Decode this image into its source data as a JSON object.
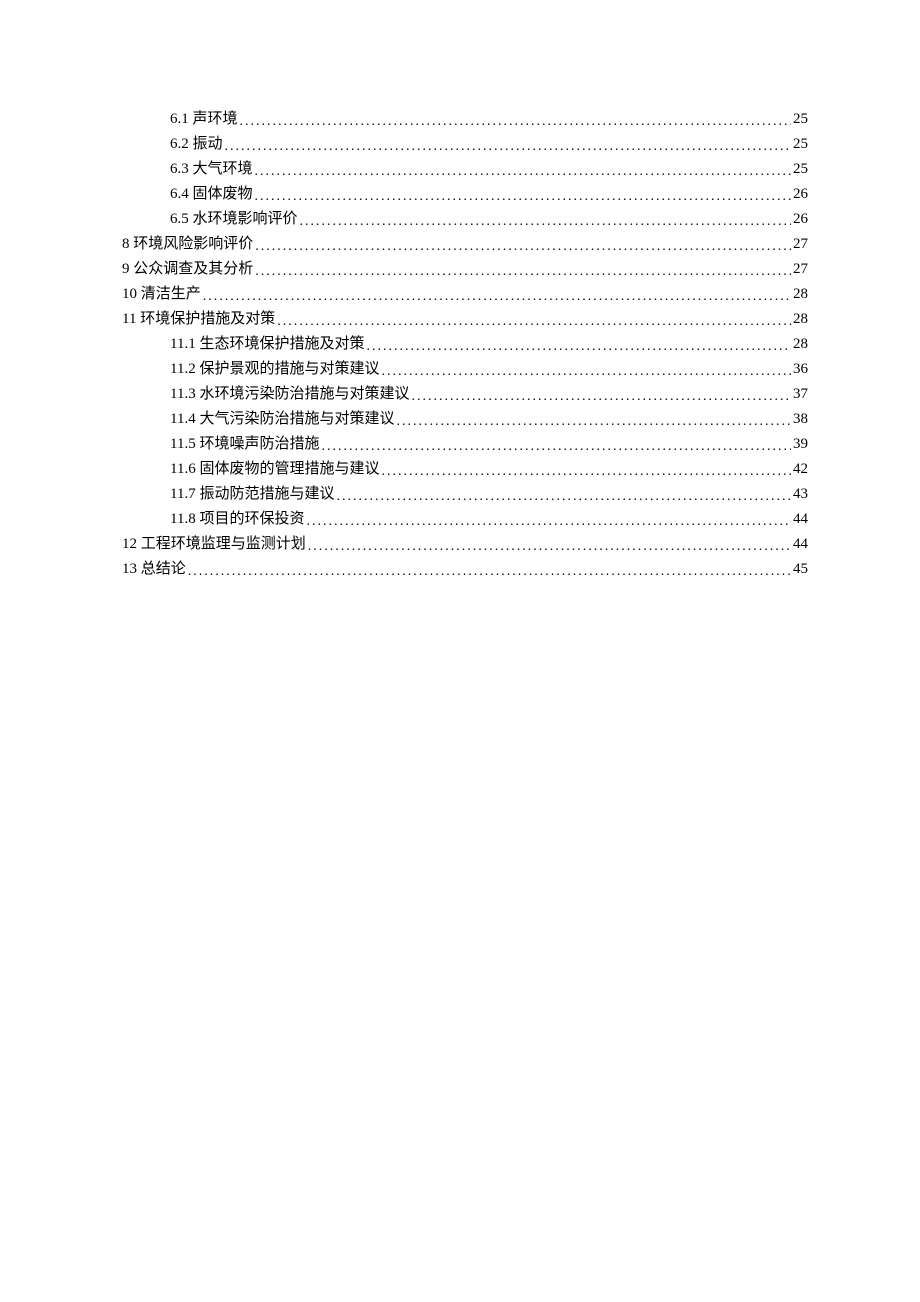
{
  "toc": [
    {
      "level": 2,
      "label": "6.1 声环境",
      "page": "25"
    },
    {
      "level": 2,
      "label": "6.2 振动",
      "page": "25"
    },
    {
      "level": 2,
      "label": "6.3 大气环境",
      "page": "25"
    },
    {
      "level": 2,
      "label": "6.4 固体废物",
      "page": "26"
    },
    {
      "level": 2,
      "label": "6.5 水环境影响评价",
      "page": "26"
    },
    {
      "level": 1,
      "label": "8 环境风险影响评价",
      "page": "27"
    },
    {
      "level": 1,
      "label": "9 公众调查及其分析",
      "page": "27"
    },
    {
      "level": 1,
      "label": "10 清洁生产",
      "page": "28"
    },
    {
      "level": 1,
      "label": "11 环境保护措施及对策",
      "page": "28"
    },
    {
      "level": 2,
      "label": "11.1 生态环境保护措施及对策",
      "page": "28"
    },
    {
      "level": 2,
      "label": "11.2 保护景观的措施与对策建议",
      "page": "36"
    },
    {
      "level": 2,
      "label": "11.3 水环境污染防治措施与对策建议",
      "page": "37"
    },
    {
      "level": 2,
      "label": "11.4 大气污染防治措施与对策建议",
      "page": "38"
    },
    {
      "level": 2,
      "label": "11.5 环境噪声防治措施",
      "page": "39"
    },
    {
      "level": 2,
      "label": "11.6 固体废物的管理措施与建议",
      "page": "42"
    },
    {
      "level": 2,
      "label": "11.7 振动防范措施与建议",
      "page": "43"
    },
    {
      "level": 2,
      "label": "11.8 项目的环保投资",
      "page": "44"
    },
    {
      "level": 1,
      "label": "12 工程环境监理与监测计划",
      "page": "44"
    },
    {
      "level": 1,
      "label": "13 总结论",
      "page": "45"
    }
  ]
}
